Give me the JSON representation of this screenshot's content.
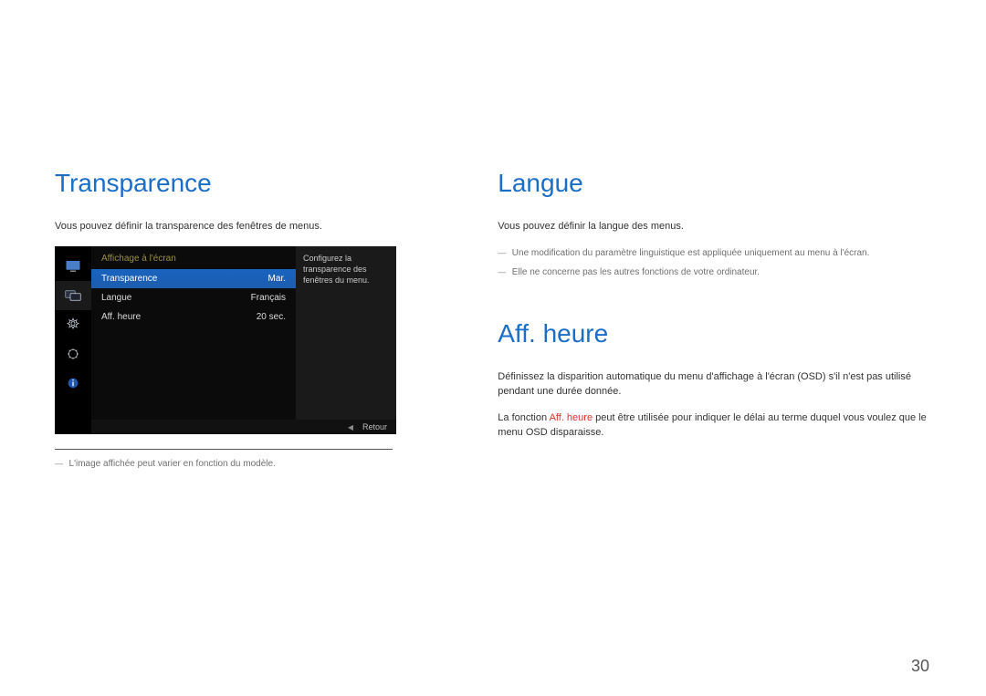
{
  "left": {
    "title": "Transparence",
    "intro": "Vous pouvez définir la transparence des fenêtres de menus.",
    "osd": {
      "header": "Affichage à l'écran",
      "rows": [
        {
          "label": "Transparence",
          "value": "Mar."
        },
        {
          "label": "Langue",
          "value": "Français"
        },
        {
          "label": "Aff. heure",
          "value": "20 sec."
        }
      ],
      "desc": "Configurez la transparence des fenêtres du menu.",
      "footer": {
        "arrow": "◀",
        "label": "Retour"
      }
    },
    "footnote": "L'image affichée peut varier en fonction du modèle."
  },
  "right": {
    "langue": {
      "title": "Langue",
      "intro": "Vous pouvez définir la langue des menus.",
      "notes": [
        "Une modification du paramètre linguistique est appliquée uniquement au menu à l'écran.",
        "Elle ne concerne pas les autres fonctions de votre ordinateur."
      ]
    },
    "affheure": {
      "title": "Aff. heure",
      "p1": "Définissez la disparition automatique du menu d'affichage à l'écran (OSD) s'il n'est pas utilisé pendant une durée donnée.",
      "p2_pre": "La fonction ",
      "p2_hl": "Aff. heure",
      "p2_post": " peut être utilisée pour indiquer le délai au terme duquel vous voulez que le menu OSD disparaisse."
    }
  },
  "page_number": "30"
}
